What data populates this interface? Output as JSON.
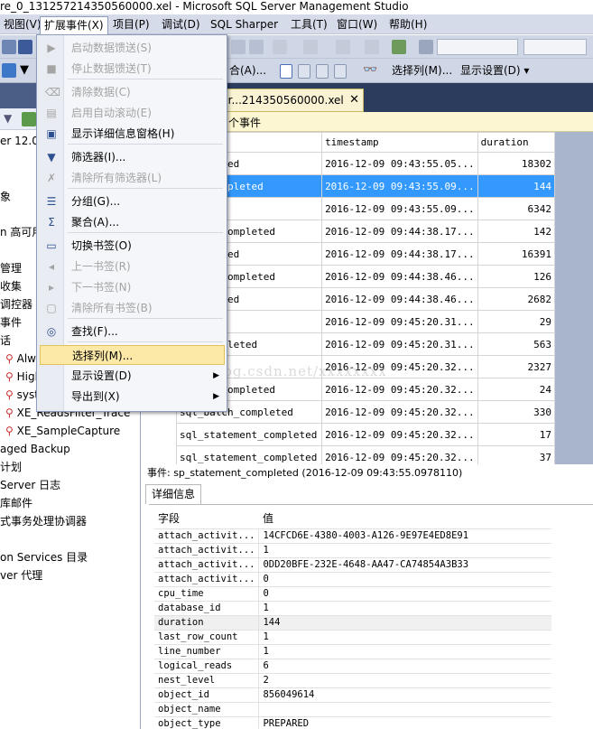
{
  "window": {
    "title": "re_0_131257214350560000.xel - Microsoft SQL Server Management Studio"
  },
  "menubar": {
    "items": [
      "视图(V)",
      "扩展事件(X)",
      "项目(P)",
      "调试(D)",
      "SQL Sharper",
      "工具(T)",
      "窗口(W)",
      "帮助(H)"
    ]
  },
  "toolbar2": {
    "merge_label": "合(A)...",
    "choose_columns": "选择列(M)...",
    "display_settings": "显示设置(D) ▾"
  },
  "dropdown": {
    "items": [
      {
        "label": "启动数据馈送(S)",
        "icon": "play-icon",
        "disabled": true
      },
      {
        "label": "停止数据馈送(T)",
        "icon": "stop-icon",
        "disabled": true
      },
      {
        "label": "清除数据(C)",
        "icon": "eraser-icon",
        "disabled": true
      },
      {
        "label": "启用自动滚动(E)",
        "icon": "autoscroll-icon",
        "disabled": true
      },
      {
        "label": "显示详细信息窗格(H)",
        "icon": "details-pane-icon",
        "disabled": false
      },
      {
        "label": "筛选器(I)...",
        "icon": "filter-icon",
        "disabled": false
      },
      {
        "label": "清除所有筛选器(L)",
        "icon": "clear-filter-icon",
        "disabled": true
      },
      {
        "label": "分组(G)...",
        "icon": "group-icon",
        "disabled": false
      },
      {
        "label": "聚合(A)...",
        "icon": "sigma-icon",
        "disabled": false
      },
      {
        "label": "切换书签(O)",
        "icon": "bookmark-icon",
        "disabled": false
      },
      {
        "label": "上一书签(R)",
        "icon": "prev-bookmark-icon",
        "disabled": true
      },
      {
        "label": "下一书签(N)",
        "icon": "next-bookmark-icon",
        "disabled": true
      },
      {
        "label": "清除所有书签(B)",
        "icon": "clear-bookmarks-icon",
        "disabled": true
      },
      {
        "label": "查找(F)...",
        "icon": "binoculars-icon",
        "disabled": false
      },
      {
        "label": "选择列(M)...",
        "icon": "",
        "disabled": false,
        "highlighted": true
      },
      {
        "label": "显示设置(D)",
        "icon": "",
        "disabled": false,
        "submenu": true
      },
      {
        "label": "导出到(X)",
        "icon": "",
        "disabled": false,
        "submenu": true
      }
    ]
  },
  "tree": {
    "items": [
      "er 12.0.",
      "象",
      "n 高可用",
      "管理",
      "收集",
      "调控器",
      "事件",
      "话",
      "Alway",
      "HighP",
      "system",
      "XE_ReadsFilter_Trace",
      "XE_SampleCapture",
      "aged Backup",
      "计划",
      "Server 日志",
      "库邮件",
      "式事务处理协调器",
      "on Services 目录",
      "ver 代理"
    ]
  },
  "document_tab": {
    "title": "ur...214350560000.xel",
    "close": "✕"
  },
  "infobar": {
    "text": "个事件"
  },
  "grid": {
    "headers": [
      "",
      "timestamp",
      "duration"
    ],
    "rows": [
      {
        "name": "_completed",
        "ts": "2016-12-09 09:43:55.05...",
        "dur": "18302",
        "selected": false
      },
      {
        "name": "tent_completed",
        "ts": "2016-12-09 09:43:55.09...",
        "dur": "144",
        "selected": true
      },
      {
        "name": "eted",
        "ts": "2016-12-09 09:43:55.09...",
        "dur": "6342",
        "selected": false
      },
      {
        "name": "tement_completed",
        "ts": "2016-12-09 09:44:38.17...",
        "dur": "142",
        "selected": false
      },
      {
        "name": "_completed",
        "ts": "2016-12-09 09:44:38.17...",
        "dur": "16391",
        "selected": false
      },
      {
        "name": "tement_completed",
        "ts": "2016-12-09 09:44:38.46...",
        "dur": "126",
        "selected": false
      },
      {
        "name": "_completed",
        "ts": "2016-12-09 09:44:38.46...",
        "dur": "2682",
        "selected": false
      },
      {
        "name": "eted",
        "ts": "2016-12-09 09:45:20.31...",
        "dur": "29",
        "selected": false
      },
      {
        "name": "ent_completed",
        "ts": "2016-12-09 09:45:20.31...",
        "dur": "563",
        "selected": false
      },
      {
        "name": "eted",
        "ts": "2016-12-09 09:45:20.32...",
        "dur": "2327",
        "selected": false
      },
      {
        "name": "tement_completed",
        "ts": "2016-12-09 09:45:20.32...",
        "dur": "24",
        "selected": false
      },
      {
        "name": "sql_batch_completed",
        "ts": "2016-12-09 09:45:20.32...",
        "dur": "330",
        "selected": false
      },
      {
        "name": "sql_statement_completed",
        "ts": "2016-12-09 09:45:20.32...",
        "dur": "17",
        "selected": false
      },
      {
        "name": "sql_statement_completed",
        "ts": "2016-12-09 09:45:20.32...",
        "dur": "37",
        "selected": false
      }
    ]
  },
  "event_line": "事件: sp_statement_completed (2016-12-09 09:43:55.0978110)",
  "details": {
    "tab": "详细信息",
    "header_field": "字段",
    "header_value": "值",
    "rows": [
      {
        "f": "attach_activit...",
        "v": "14CFCD6E-4380-4003-A126-9E97E4ED8E91"
      },
      {
        "f": "attach_activit...",
        "v": "1"
      },
      {
        "f": "attach_activit...",
        "v": "0DD20BFE-232E-4648-AA47-CA74854A3B33"
      },
      {
        "f": "attach_activit...",
        "v": "0"
      },
      {
        "f": "cpu_time",
        "v": "0"
      },
      {
        "f": "database_id",
        "v": "1"
      },
      {
        "f": "duration",
        "v": "144"
      },
      {
        "f": "last_row_count",
        "v": "1"
      },
      {
        "f": "line_number",
        "v": "1"
      },
      {
        "f": "logical_reads",
        "v": "6"
      },
      {
        "f": "nest_level",
        "v": "2"
      },
      {
        "f": "object_id",
        "v": "856049614"
      },
      {
        "f": "object_name",
        "v": ""
      },
      {
        "f": "object_type",
        "v": "PREPARED"
      }
    ]
  },
  "watermark": "http://blog.csdn.net/xxxxxxxx",
  "colors": {
    "selection": "#3399ff",
    "menu_highlight": "#fce9a8",
    "doc_tab": "#f9f3d4",
    "tabbar": "#2b3c5c"
  }
}
